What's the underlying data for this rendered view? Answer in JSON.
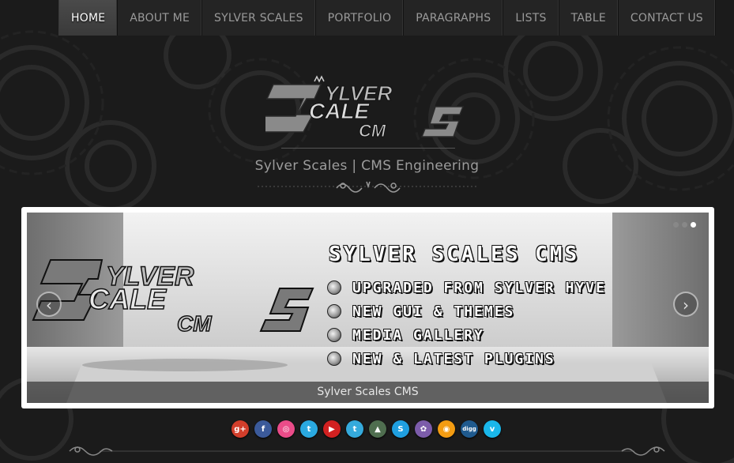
{
  "nav": {
    "items": [
      {
        "label": "HOME",
        "active": true
      },
      {
        "label": "ABOUT ME"
      },
      {
        "label": "SYLVER SCALES"
      },
      {
        "label": "PORTFOLIO"
      },
      {
        "label": "PARAGRAPHS"
      },
      {
        "label": "LISTS"
      },
      {
        "label": "TABLE"
      },
      {
        "label": "CONTACT US"
      }
    ]
  },
  "header": {
    "logo_text": "SYLVER SCALES CMS",
    "tagline": "Sylver Scales | CMS Engineering"
  },
  "slider": {
    "slide_logo_text": "SYLVER SCALES CMS",
    "title": "SYLVER SCALES CMS",
    "features": [
      "UPGRADED FROM SYLVER HYVE",
      "NEW GUI & THEMES",
      "MEDIA GALLERY",
      "NEW & LATEST PLUGINS"
    ],
    "caption": "Sylver Scales CMS",
    "prev_icon": "‹",
    "next_icon": "›",
    "dots_active_index": 2
  },
  "social": [
    {
      "name": "google-plus-icon",
      "glyph": "g+",
      "color": "#d23e2b"
    },
    {
      "name": "facebook-icon",
      "glyph": "f",
      "color": "#3b5a9a"
    },
    {
      "name": "dribbble-icon",
      "glyph": "◎",
      "color": "#ea4c89"
    },
    {
      "name": "twitter-icon",
      "glyph": "t",
      "color": "#2aa9e0"
    },
    {
      "name": "youtube-icon",
      "glyph": "▶",
      "color": "#d12121"
    },
    {
      "name": "tumblr-icon",
      "glyph": "t",
      "color": "#35aadc"
    },
    {
      "name": "forrst-icon",
      "glyph": "▲",
      "color": "#4f6e4f"
    },
    {
      "name": "skype-icon",
      "glyph": "S",
      "color": "#1f9fe0"
    },
    {
      "name": "flickr-icon",
      "glyph": "✿",
      "color": "#7c5caa"
    },
    {
      "name": "rss-icon",
      "glyph": "◉",
      "color": "#f39c12"
    },
    {
      "name": "digg-icon",
      "glyph": "digg",
      "color": "#1f5a8e"
    },
    {
      "name": "vimeo-icon",
      "glyph": "v",
      "color": "#1ab7ea"
    }
  ]
}
